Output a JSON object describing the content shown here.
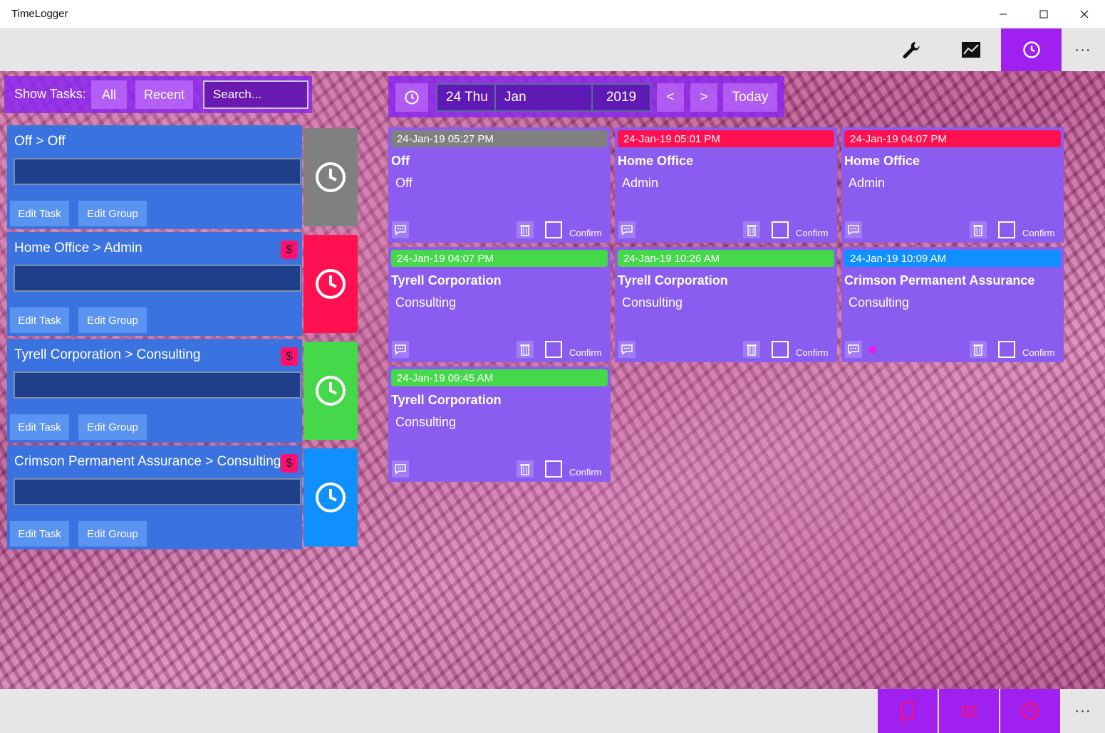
{
  "window": {
    "title": "TimeLogger"
  },
  "topbar": {
    "buttons": [
      "wrench-icon",
      "chart-icon",
      "clock-icon"
    ],
    "active": "clock-icon",
    "more": "···"
  },
  "filter": {
    "label": "Show Tasks:",
    "all": "All",
    "recent": "Recent",
    "search_placeholder": "Search..."
  },
  "tasks": [
    {
      "name": "Off > Off",
      "billable": false,
      "edit_task": "Edit Task",
      "edit_group": "Edit Group",
      "color": "#808080"
    },
    {
      "name": "Home Office > Admin",
      "billable": true,
      "billable_label": "$",
      "edit_task": "Edit Task",
      "edit_group": "Edit Group",
      "color": "#ff1050"
    },
    {
      "name": "Tyrell Corporation > Consulting",
      "billable": true,
      "billable_label": "$",
      "edit_task": "Edit Task",
      "edit_group": "Edit Group",
      "color": "#44d84a"
    },
    {
      "name": "Crimson Permanent Assurance > Consulting",
      "billable": true,
      "billable_label": "$",
      "edit_task": "Edit Task",
      "edit_group": "Edit Group",
      "color": "#1090ff"
    }
  ],
  "datebar": {
    "day": "24 Thu",
    "month": "Jan",
    "year": "2019",
    "prev": "<",
    "next": ">",
    "today": "Today"
  },
  "entries": [
    {
      "time": "24-Jan-19 05:27 PM",
      "group": "Off",
      "task": "Off",
      "color": "#808080",
      "confirm": "Confirm",
      "has_comment": false
    },
    {
      "time": "24-Jan-19 05:01 PM",
      "group": "Home Office",
      "task": "Admin",
      "color": "#ff1050",
      "confirm": "Confirm",
      "has_comment": false
    },
    {
      "time": "24-Jan-19 04:07 PM",
      "group": "Home Office",
      "task": "Admin",
      "color": "#ff1050",
      "confirm": "Confirm",
      "has_comment": false
    },
    {
      "time": "24-Jan-19 04:07 PM",
      "group": "Tyrell Corporation",
      "task": "Consulting",
      "color": "#44d84a",
      "confirm": "Confirm",
      "has_comment": false
    },
    {
      "time": "24-Jan-19 10:26 AM",
      "group": "Tyrell Corporation",
      "task": "Consulting",
      "color": "#44d84a",
      "confirm": "Confirm",
      "has_comment": false
    },
    {
      "time": "24-Jan-19 10:09 AM",
      "group": "Crimson Permanent Assurance",
      "task": "Consulting",
      "color": "#1090ff",
      "confirm": "Confirm",
      "has_comment": true
    },
    {
      "time": "24-Jan-19 09:45 AM",
      "group": "Tyrell Corporation",
      "task": "Consulting",
      "color": "#44d84a",
      "confirm": "Confirm",
      "has_comment": false
    }
  ],
  "bottombar": {
    "buttons": [
      "new-entry-icon",
      "edit-entry-icon",
      "clock-icon"
    ],
    "more": "···"
  },
  "colors": {
    "accent": "#a020f0",
    "task_bg": "#3a72e0",
    "entry_bg": "#8a5cf0"
  }
}
